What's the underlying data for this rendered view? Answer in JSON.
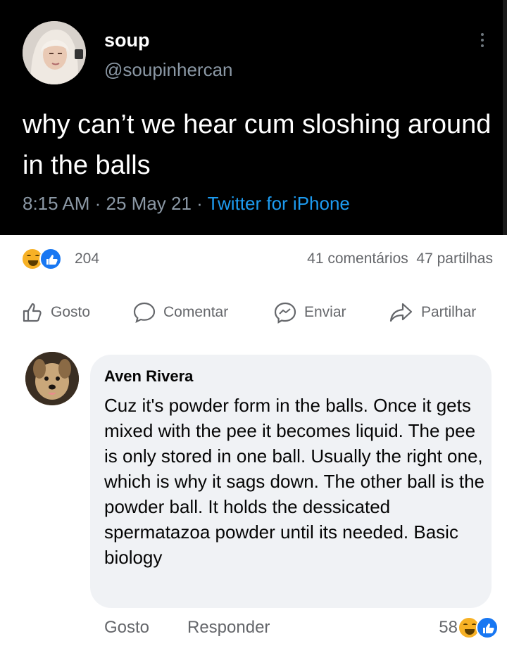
{
  "tweet": {
    "display_name": "soup",
    "handle": "@soupinhercan",
    "text": "why can’t we hear cum sloshing around in the balls",
    "time": "8:15 AM",
    "date": "25 May 21",
    "source": "Twitter for iPhone",
    "separator": " · "
  },
  "post": {
    "reaction_count": "204",
    "comments": "41 comentários",
    "shares": "47 partilhas",
    "actions": {
      "like": "Gosto",
      "comment": "Comentar",
      "send": "Enviar",
      "share": "Partilhar"
    }
  },
  "comment": {
    "author": "Aven Rivera",
    "text": "Cuz it's powder form in the balls. Once it gets mixed with the pee it becomes liquid. The pee is only stored in one ball. Usually the right one, which is why it sags down. The other ball is the powder ball. It holds the dessicated spermatazoa powder until its needed. Basic biology",
    "like_label": "Gosto",
    "reply_label": "Responder",
    "reaction_count": "58"
  },
  "colors": {
    "tweet_bg": "#000000",
    "twitter_blue": "#1d9bf0",
    "fb_blue": "#1877f2",
    "haha_yellow": "#f7b125",
    "bubble_bg": "#f0f2f5",
    "secondary_text": "#65676b"
  }
}
